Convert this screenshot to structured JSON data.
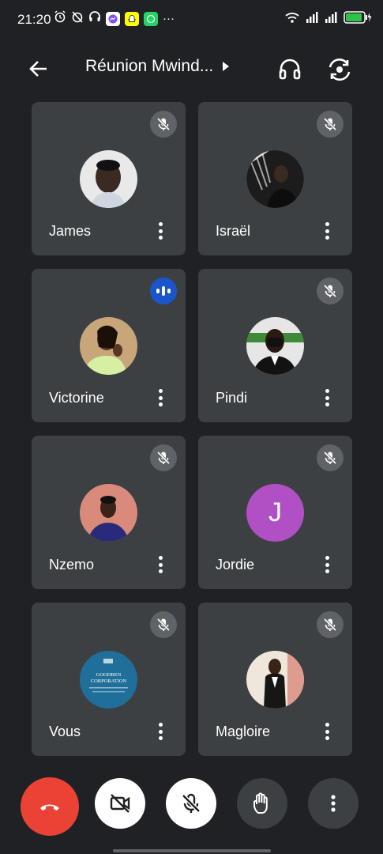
{
  "status_bar": {
    "time": "21:20",
    "more_indicator": "···",
    "battery_color": "#2ec24a"
  },
  "header": {
    "title": "Réunion Mwind...",
    "back_icon": "arrow-left-icon",
    "audio_icon": "headphones-icon",
    "switch_icon": "switch-camera-icon"
  },
  "participants": [
    {
      "name": "James",
      "mic": "muted",
      "avatar": "photo"
    },
    {
      "name": "Israël",
      "mic": "muted",
      "avatar": "photo"
    },
    {
      "name": "Victorine",
      "mic": "speaking",
      "avatar": "photo"
    },
    {
      "name": "Pindi",
      "mic": "muted",
      "avatar": "photo"
    },
    {
      "name": "Nzemo",
      "mic": "muted",
      "avatar": "photo"
    },
    {
      "name": "Jordie",
      "mic": "muted",
      "avatar": "letter",
      "initial": "J",
      "avatar_color": "#b14fc5"
    },
    {
      "name": "Vous",
      "mic": "muted",
      "avatar": "logo",
      "logo_text": "GOODBEN\nCORPORATION"
    },
    {
      "name": "Magloire",
      "mic": "muted",
      "avatar": "photo"
    }
  ],
  "controls": [
    {
      "icon": "end-call-icon",
      "color": "#ea4335"
    },
    {
      "icon": "camera-off-icon",
      "color": "#ffffff"
    },
    {
      "icon": "mic-off-icon",
      "color": "#ffffff"
    },
    {
      "icon": "raise-hand-icon",
      "color": "#3c4043"
    },
    {
      "icon": "more-options-icon",
      "color": "#3c4043"
    }
  ]
}
